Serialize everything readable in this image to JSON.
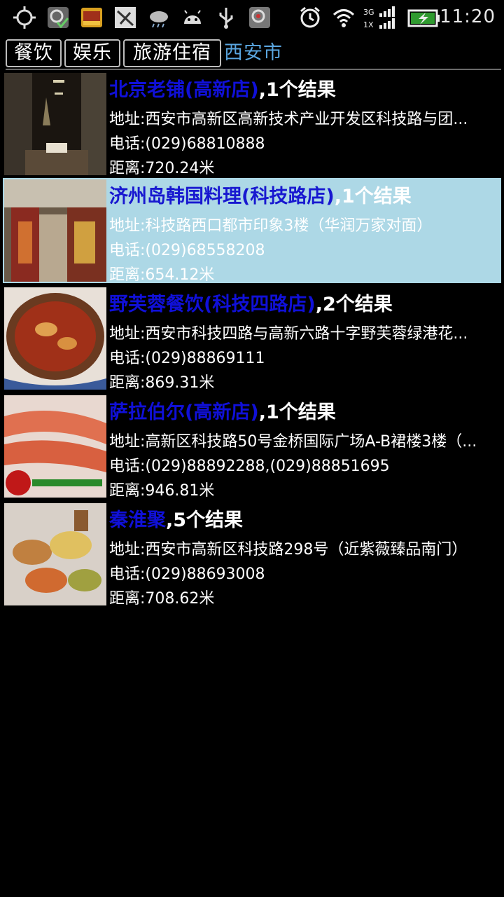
{
  "status_bar": {
    "time": "11:20",
    "icons": [
      "gps-icon",
      "map-app-icon",
      "taobao-icon",
      "usb-debug-icon",
      "weather-icon",
      "android-icon",
      "usb-icon",
      "app-notify-icon",
      "alarm-icon",
      "wifi-icon",
      "signal-3g-icon",
      "battery-charging-icon"
    ]
  },
  "tabs": {
    "food": "餐饮",
    "entertainment": "娱乐",
    "travel": "旅游住宿",
    "city": "西安市"
  },
  "results": [
    {
      "name": "北京老铺(高新店)",
      "count": ",1个结果",
      "address": "地址:西安市高新区高新技术产业开发区科技路与团...",
      "phone": "电话:(029)68810888",
      "distance": "距离:720.24米",
      "selected": false
    },
    {
      "name": "济州岛韩国料理(科技路店)",
      "count": ",1个结果",
      "address": "地址:科技路西口都市印象3楼（华润万家对面）",
      "phone": "电话:(029)68558208",
      "distance": "距离:654.12米",
      "selected": true
    },
    {
      "name": "野芙蓉餐饮(科技四路店)",
      "count": ",2个结果",
      "address": "地址:西安市科技四路与高新六路十字野芙蓉绿港花...",
      "phone": "电话:(029)88869111",
      "distance": "距离:869.31米",
      "selected": false
    },
    {
      "name": "萨拉伯尔(高新店)",
      "count": ",1个结果",
      "address": "地址:高新区科技路50号金桥国际广场A-B裙楼3楼（...",
      "phone": "电话:(029)88892288,(029)88851695",
      "distance": "距离:946.81米",
      "selected": false
    },
    {
      "name": "秦淮聚",
      "count": ",5个结果",
      "address": "地址:西安市高新区科技路298号（近紫薇臻品南门）",
      "phone": "电话:(029)88693008",
      "distance": "距离:708.62米",
      "selected": false
    }
  ]
}
